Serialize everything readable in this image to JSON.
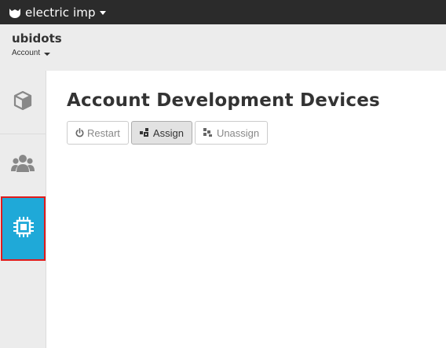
{
  "topbar": {
    "brand_text": "electric imp"
  },
  "account": {
    "name": "ubidots",
    "dropdown_label": "Account"
  },
  "sidebar": {
    "items": [
      {
        "icon": "cube-icon"
      },
      {
        "icon": "users-icon"
      },
      {
        "icon": "chip-icon",
        "active": true
      }
    ]
  },
  "main": {
    "title": "Account Development Devices",
    "buttons": [
      {
        "label": "Restart",
        "icon": "power-icon"
      },
      {
        "label": "Assign",
        "icon": "assign-icon"
      },
      {
        "label": "Unassign",
        "icon": "unassign-icon"
      }
    ]
  },
  "colors": {
    "topbar_bg": "#2b2b2b",
    "active_item_bg": "#1fa9d8",
    "active_item_border": "#e01b1b"
  }
}
